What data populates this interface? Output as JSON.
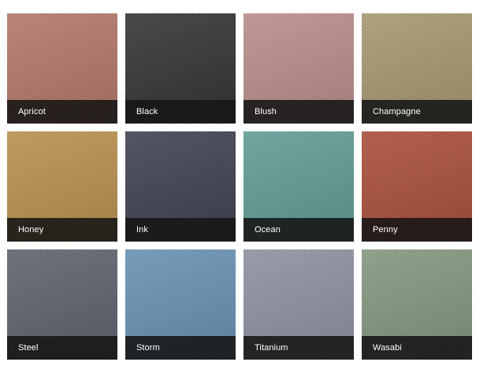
{
  "swatches": [
    {
      "name": "Apricot",
      "color": "#b57565"
    },
    {
      "name": "Black",
      "color": "#2d2e30"
    },
    {
      "name": "Blush",
      "color": "#bb8c88"
    },
    {
      "name": "Champagne",
      "color": "#a7976e"
    },
    {
      "name": "Honey",
      "color": "#bb8f4b"
    },
    {
      "name": "Ink",
      "color": "#393d4c"
    },
    {
      "name": "Ocean",
      "color": "#5d9c95"
    },
    {
      "name": "Penny",
      "color": "#ab4a35"
    },
    {
      "name": "Steel",
      "color": "#5a5f6c"
    },
    {
      "name": "Storm",
      "color": "#6690b5"
    },
    {
      "name": "Titanium",
      "color": "#8c91a0"
    },
    {
      "name": "Wasabi",
      "color": "#82977c"
    }
  ]
}
